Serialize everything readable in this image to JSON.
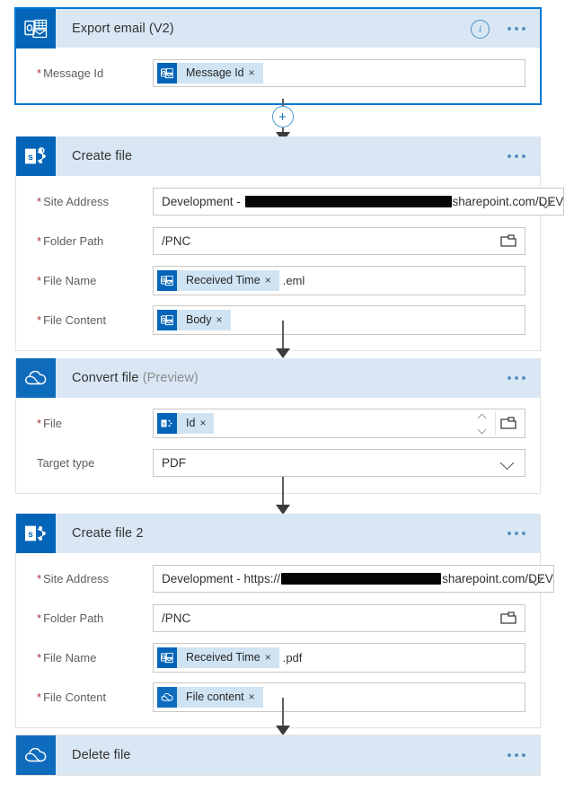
{
  "flow": {
    "cards": [
      {
        "id": "export-email-v2",
        "title": "Export email (V2)",
        "title_suffix": "",
        "connector": "outlook",
        "selected": true,
        "has_info": true,
        "fields": [
          {
            "label": "Message Id",
            "required": true,
            "control": "token",
            "token": {
              "label": "Message Id",
              "icon": "outlook",
              "close": "×"
            },
            "suffix": ""
          }
        ]
      },
      {
        "id": "create-file",
        "title": "Create file",
        "title_suffix": "",
        "connector": "sharepoint",
        "selected": false,
        "has_info": false,
        "fields": [
          {
            "label": "Site Address",
            "required": true,
            "control": "dropdown",
            "text_before": "Development - ",
            "redacted_width": 230,
            "text_after": "sharepoint.com/DEV"
          },
          {
            "label": "Folder Path",
            "required": true,
            "control": "folder",
            "value": "/PNC"
          },
          {
            "label": "File Name",
            "required": true,
            "control": "token",
            "token": {
              "label": "Received Time",
              "icon": "outlook",
              "close": "×"
            },
            "suffix": ".eml"
          },
          {
            "label": "File Content",
            "required": true,
            "control": "token",
            "token": {
              "label": "Body",
              "icon": "outlook",
              "close": "×"
            },
            "suffix": ""
          }
        ]
      },
      {
        "id": "convert-file",
        "title": "Convert file",
        "title_suffix": "(Preview)",
        "connector": "onedrive",
        "selected": false,
        "has_info": false,
        "fields": [
          {
            "label": "File",
            "required": true,
            "control": "token-spinner-folder",
            "token": {
              "label": "Id",
              "icon": "sharepoint",
              "close": "×"
            },
            "suffix": ""
          },
          {
            "label": "Target type",
            "required": false,
            "control": "dropdown",
            "value": "PDF"
          }
        ]
      },
      {
        "id": "create-file-2",
        "title": "Create file 2",
        "title_suffix": "",
        "connector": "sharepoint",
        "selected": false,
        "has_info": false,
        "fields": [
          {
            "label": "Site Address",
            "required": true,
            "control": "dropdown",
            "text_before": "Development - https://",
            "redacted_width": 178,
            "text_after": "sharepoint.com/DEV"
          },
          {
            "label": "Folder Path",
            "required": true,
            "control": "folder",
            "value": "/PNC"
          },
          {
            "label": "File Name",
            "required": true,
            "control": "token",
            "token": {
              "label": "Received Time",
              "icon": "outlook",
              "close": "×"
            },
            "suffix": ".pdf"
          },
          {
            "label": "File Content",
            "required": true,
            "control": "token",
            "token": {
              "label": "File content",
              "icon": "onedrive",
              "close": "×"
            },
            "suffix": ""
          }
        ]
      },
      {
        "id": "delete-file",
        "title": "Delete file",
        "title_suffix": "",
        "connector": "onedrive",
        "selected": false,
        "has_info": false,
        "fields": []
      }
    ],
    "connectors": [
      {
        "has_plus": true,
        "plus_label": "+"
      },
      {
        "has_plus": false,
        "plus_label": ""
      },
      {
        "has_plus": false,
        "plus_label": ""
      },
      {
        "has_plus": false,
        "plus_label": ""
      }
    ],
    "required_marker": "*",
    "colors": {
      "card_header_bg": "#d9e7f4",
      "connector_tile_blue": "#0364b8",
      "selected_border": "#0078d4",
      "required_asterisk": "#a4373a",
      "token_chip_bg": "#cfe3f3",
      "redaction": "#060606"
    }
  }
}
